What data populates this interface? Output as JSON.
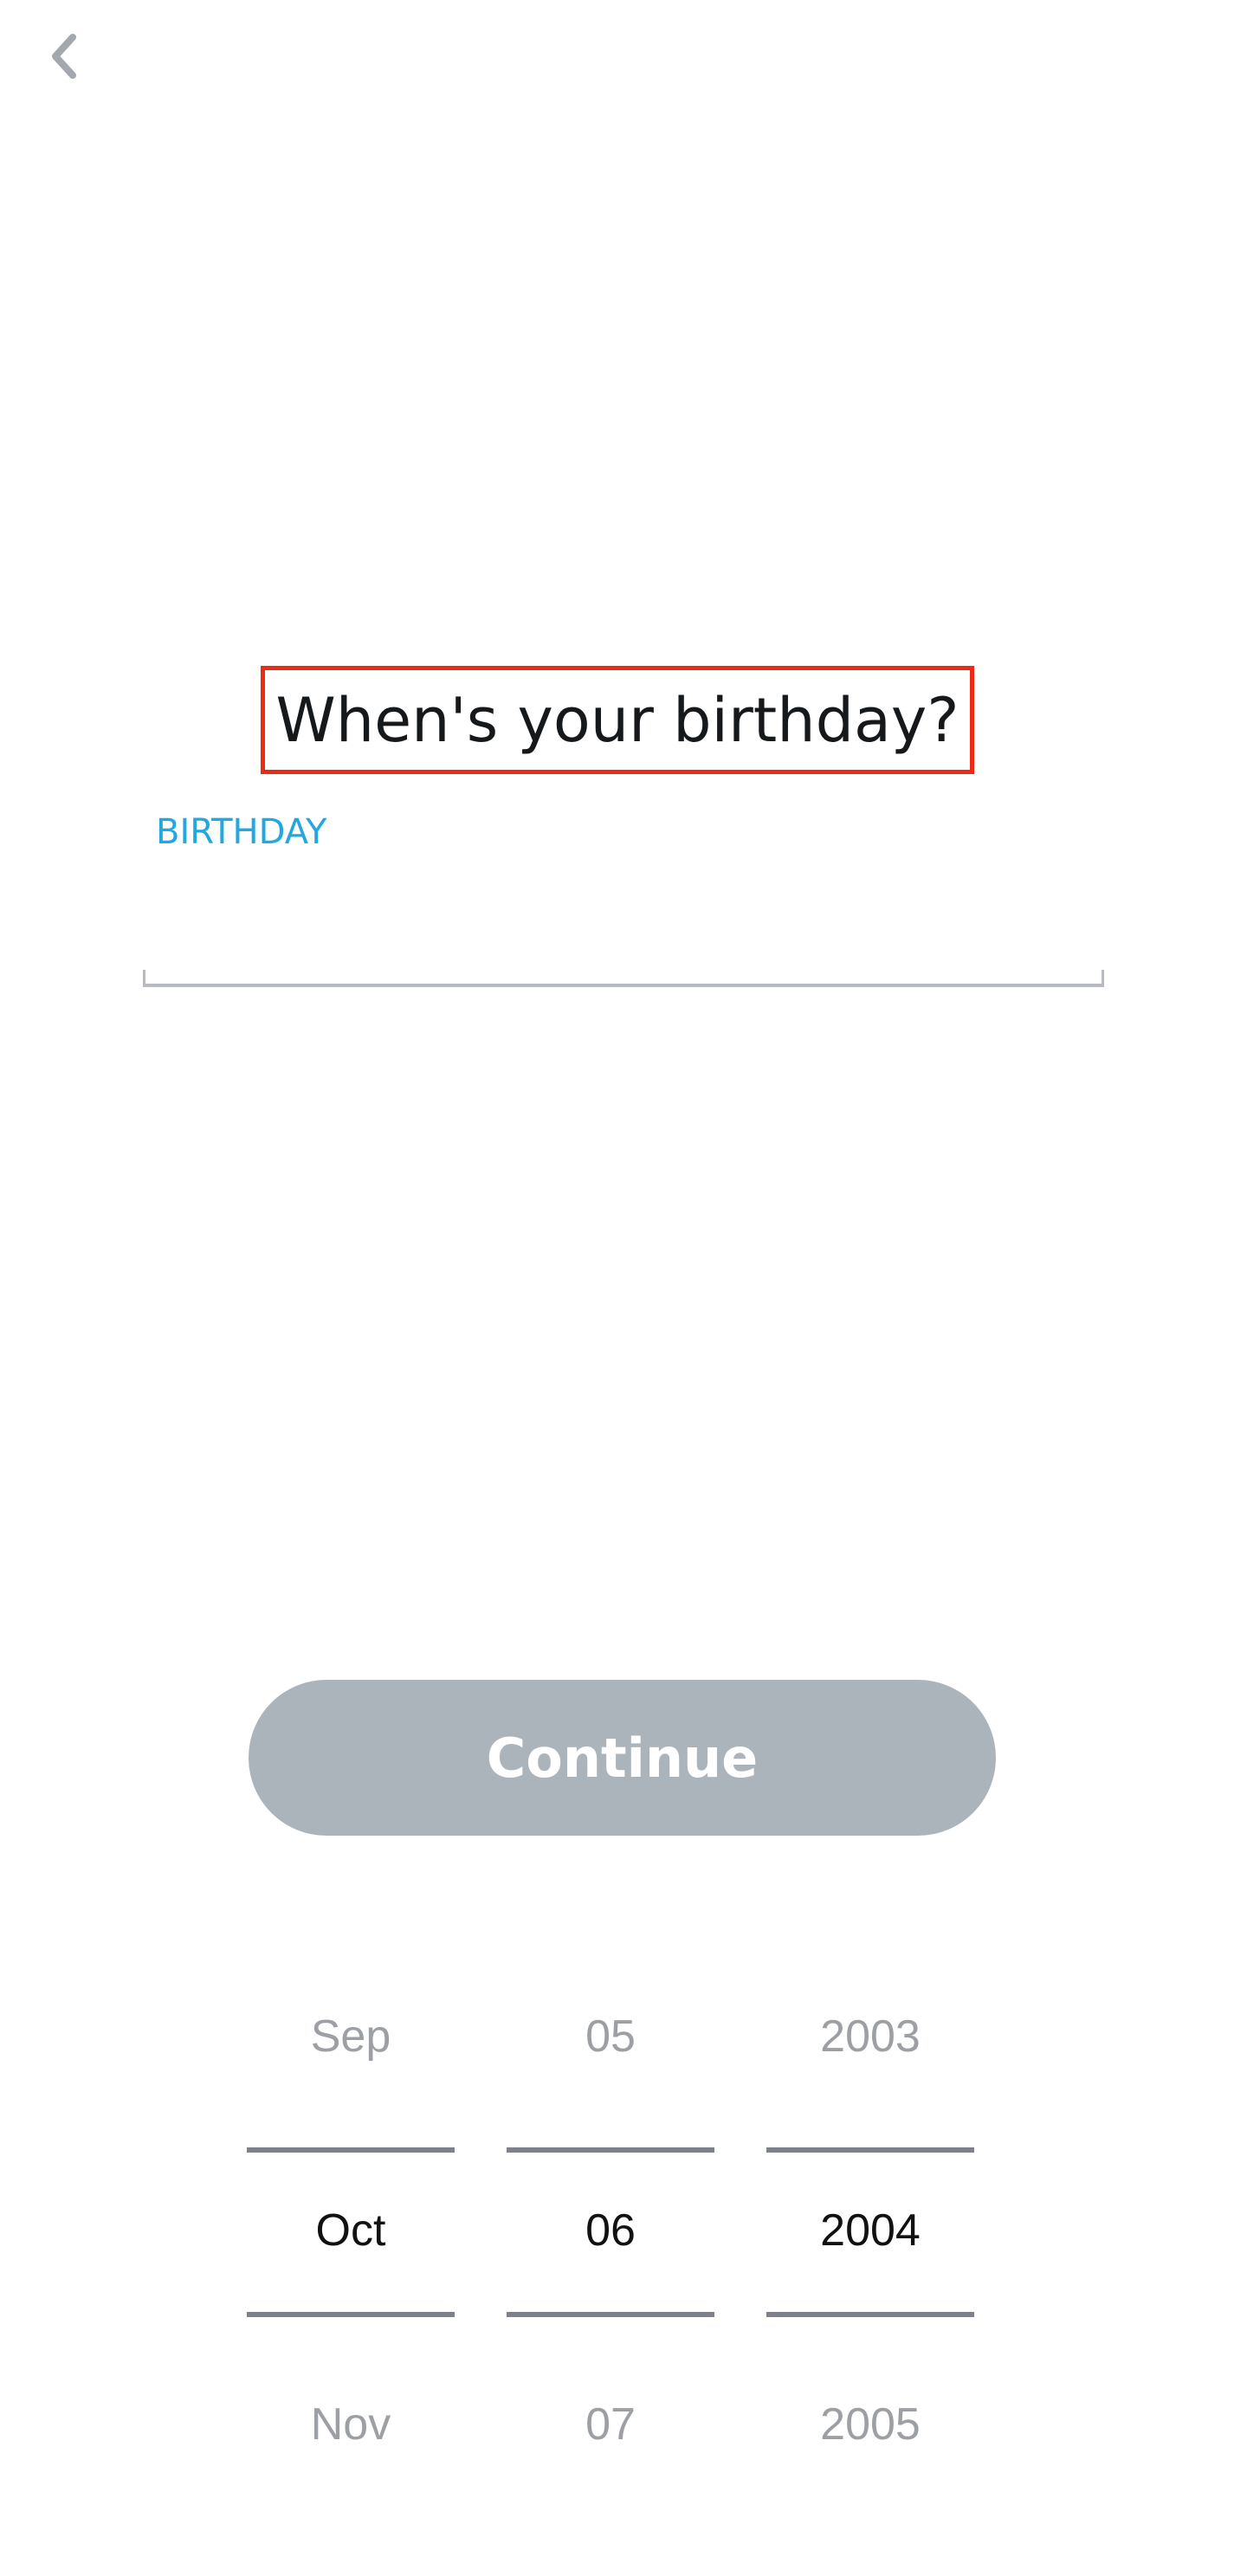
{
  "header": {
    "back_icon": "chevron-left-icon",
    "back_icon_color": "#a3a8b0"
  },
  "main": {
    "title": "When's your birthday?",
    "field": {
      "label": "BIRTHDAY",
      "value": "",
      "label_color": "#22a7df"
    }
  },
  "continue_button": {
    "label": "Continue",
    "background": "#acb4bb",
    "text_color": "#ffffff"
  },
  "date_picker": {
    "month": {
      "prev": "Sep",
      "current": "Oct",
      "next": "Nov"
    },
    "day": {
      "prev": "05",
      "current": "06",
      "next": "07"
    },
    "year": {
      "prev": "2003",
      "current": "2004",
      "next": "2005"
    }
  }
}
